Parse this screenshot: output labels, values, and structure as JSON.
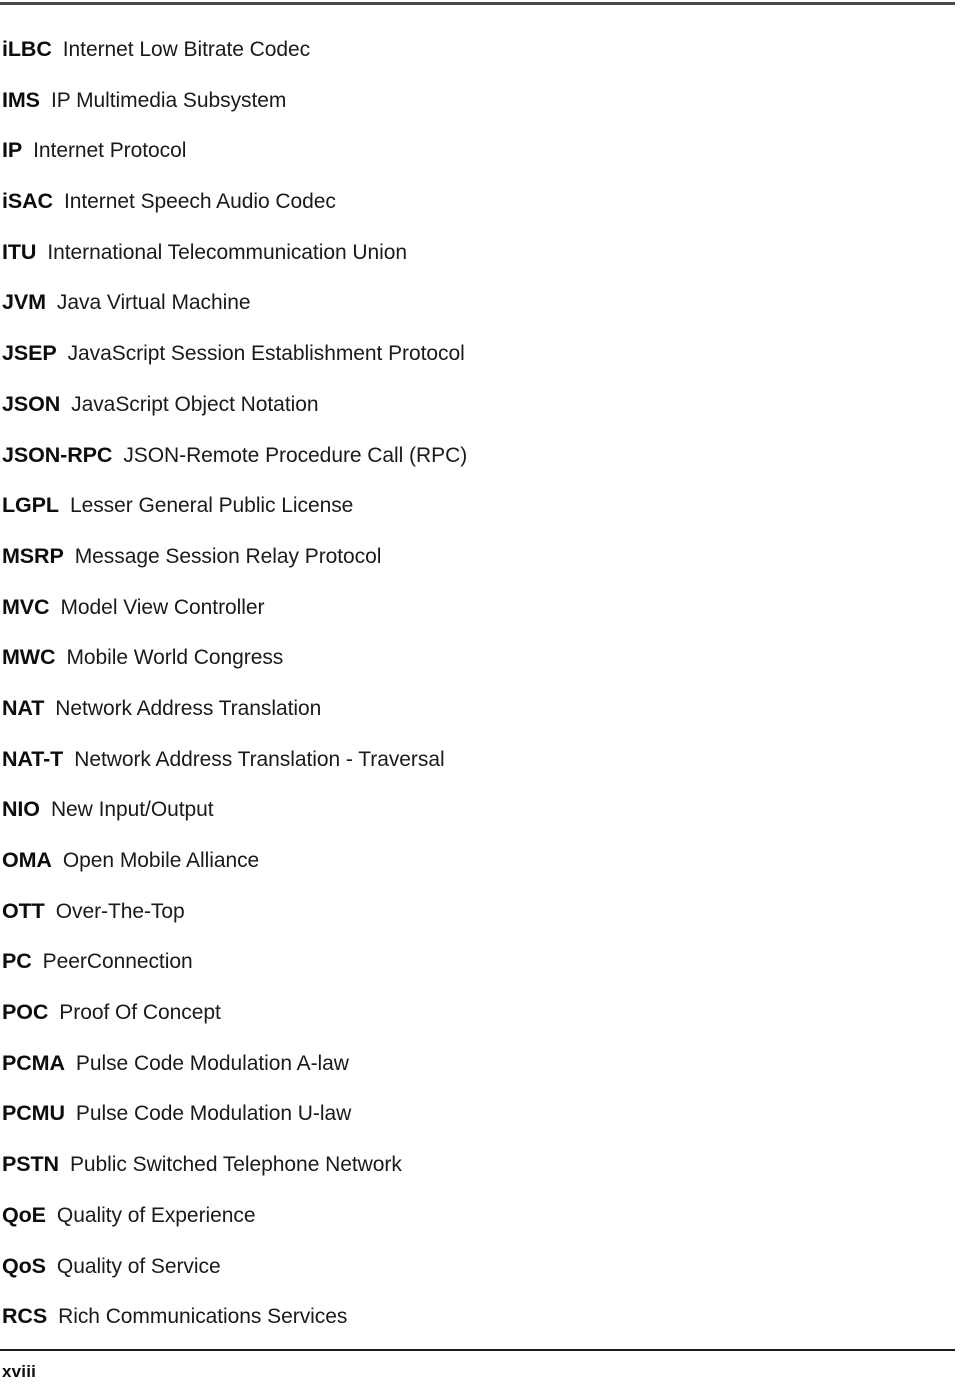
{
  "page": {
    "folio": "xviii",
    "rule_color": "#4a4a4a",
    "footer_rule_color": "#1a1a1a",
    "text_color": "#000000",
    "background": "#ffffff"
  },
  "glossary": {
    "entries": [
      {
        "term": "iLBC",
        "definition": "Internet Low Bitrate Codec"
      },
      {
        "term": "IMS",
        "definition": "IP Multimedia Subsystem"
      },
      {
        "term": "IP",
        "definition": "Internet Protocol"
      },
      {
        "term": "iSAC",
        "definition": "Internet Speech Audio Codec"
      },
      {
        "term": "ITU",
        "definition": "International Telecommunication Union"
      },
      {
        "term": "JVM",
        "definition": "Java Virtual Machine"
      },
      {
        "term": "JSEP",
        "definition": "JavaScript Session Establishment Protocol"
      },
      {
        "term": "JSON",
        "definition": "JavaScript Object Notation"
      },
      {
        "term": "JSON-RPC",
        "definition": "JSON-Remote Procedure Call (RPC)"
      },
      {
        "term": "LGPL",
        "definition": "Lesser General Public License"
      },
      {
        "term": "MSRP",
        "definition": "Message Session Relay Protocol"
      },
      {
        "term": "MVC",
        "definition": "Model View Controller"
      },
      {
        "term": "MWC",
        "definition": "Mobile World Congress"
      },
      {
        "term": "NAT",
        "definition": "Network Address Translation"
      },
      {
        "term": "NAT-T",
        "definition": "Network Address Translation - Traversal"
      },
      {
        "term": "NIO",
        "definition": "New Input/Output"
      },
      {
        "term": "OMA",
        "definition": "Open Mobile Alliance"
      },
      {
        "term": "OTT",
        "definition": "Over-The-Top"
      },
      {
        "term": "PC",
        "definition": "PeerConnection"
      },
      {
        "term": "POC",
        "definition": "Proof Of Concept"
      },
      {
        "term": "PCMA",
        "definition": "Pulse Code Modulation A-law"
      },
      {
        "term": "PCMU",
        "definition": "Pulse Code Modulation U-law"
      },
      {
        "term": "PSTN",
        "definition": "Public Switched Telephone Network"
      },
      {
        "term": "QoE",
        "definition": "Quality of Experience"
      },
      {
        "term": "QoS",
        "definition": "Quality of Service"
      },
      {
        "term": "RCS",
        "definition": "Rich Communications Services"
      }
    ]
  }
}
